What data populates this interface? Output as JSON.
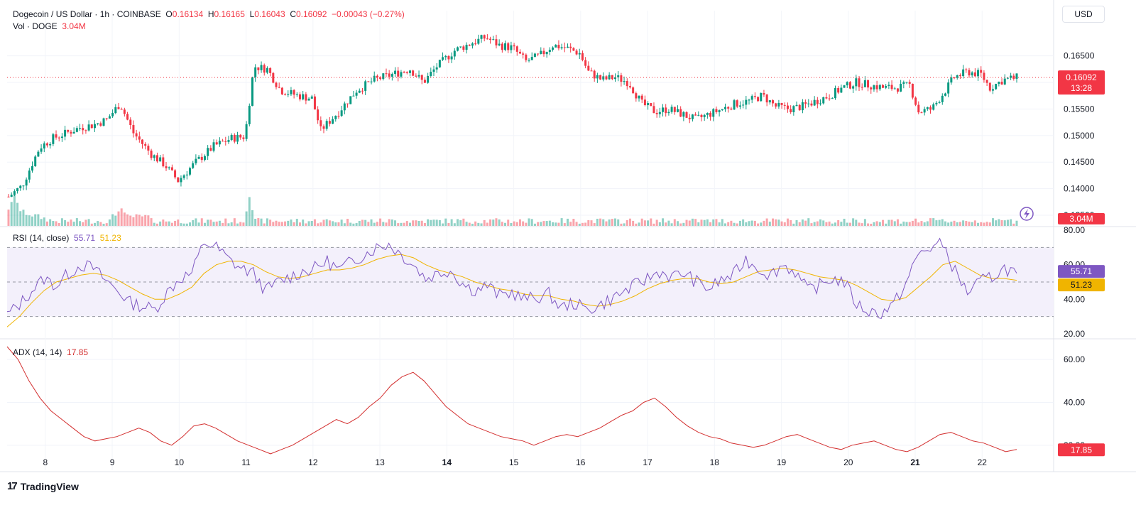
{
  "header": {
    "title": "Dogecoin / US Dollar · 1h · COINBASE",
    "o_key": "O",
    "o_val": "0.16134",
    "h_key": "H",
    "h_val": "0.16165",
    "l_key": "L",
    "l_val": "0.16043",
    "c_key": "C",
    "c_val": "0.16092",
    "change": "−0.00043 (−0.27%)",
    "vol_label": "Vol · DOGE",
    "vol_value": "3.04M"
  },
  "currency_button": "USD",
  "price_badge": {
    "value": "0.16092",
    "countdown": "13:28"
  },
  "volume_badge": "3.04M",
  "rsi_label": {
    "name": "RSI (14, close)",
    "value": "55.71",
    "ma": "51.23"
  },
  "rsi_badges": {
    "value": "55.71",
    "ma": "51.23"
  },
  "adx_label": {
    "name": "ADX (14, 14)",
    "value": "17.85"
  },
  "adx_badge": "17.85",
  "logo_text": "TradingView",
  "colors": {
    "up": "#089981",
    "down": "#f23645",
    "rsi": "#7e57c2",
    "rsi_ma": "#f0b400",
    "adx": "#d32f2f",
    "band": "#f3f0fb"
  },
  "chart_data": [
    {
      "type": "candlestick",
      "title": "Dogecoin / US Dollar · 1h · COINBASE",
      "x_ticks": [
        "8",
        "9",
        "10",
        "11",
        "12",
        "13",
        "14",
        "15",
        "16",
        "17",
        "18",
        "19",
        "20",
        "21",
        "22"
      ],
      "y_ticks": [
        "0.16500",
        "0.16000",
        "0.15500",
        "0.15000",
        "0.14500",
        "0.14000",
        "0.13500"
      ],
      "ylim": [
        0.133,
        0.1695
      ],
      "last_price": 0.16092,
      "close_path": [
        [
          0,
          0.1385
        ],
        [
          0.3,
          0.1405
        ],
        [
          0.7,
          0.1478
        ],
        [
          1.0,
          0.1495
        ],
        [
          1.3,
          0.1505
        ],
        [
          1.6,
          0.1515
        ],
        [
          1.9,
          0.152
        ],
        [
          2.2,
          0.153
        ],
        [
          2.5,
          0.156
        ],
        [
          2.8,
          0.1505
        ],
        [
          3.2,
          0.1465
        ],
        [
          3.5,
          0.1445
        ],
        [
          3.8,
          0.1415
        ],
        [
          4.2,
          0.145
        ],
        [
          4.6,
          0.148
        ],
        [
          5.0,
          0.1495
        ],
        [
          5.3,
          0.1498
        ],
        [
          5.5,
          0.163
        ],
        [
          5.8,
          0.1625
        ],
        [
          6.1,
          0.1585
        ],
        [
          6.5,
          0.1575
        ],
        [
          6.8,
          0.157
        ],
        [
          7.0,
          0.151
        ],
        [
          7.4,
          0.1545
        ],
        [
          7.8,
          0.1585
        ],
        [
          8.2,
          0.1605
        ],
        [
          8.6,
          0.1615
        ],
        [
          9.0,
          0.1625
        ],
        [
          9.3,
          0.16
        ],
        [
          9.6,
          0.163
        ],
        [
          10.0,
          0.166
        ],
        [
          10.4,
          0.1675
        ],
        [
          10.7,
          0.1685
        ],
        [
          11.0,
          0.167
        ],
        [
          11.3,
          0.1665
        ],
        [
          11.6,
          0.164
        ],
        [
          11.9,
          0.165
        ],
        [
          12.2,
          0.167
        ],
        [
          12.5,
          0.1665
        ],
        [
          12.8,
          0.1655
        ],
        [
          13.0,
          0.162
        ],
        [
          13.3,
          0.1605
        ],
        [
          13.6,
          0.161
        ],
        [
          13.9,
          0.16
        ],
        [
          14.2,
          0.156
        ],
        [
          14.5,
          0.1545
        ],
        [
          14.8,
          0.155
        ],
        [
          15.1,
          0.154
        ],
        [
          15.4,
          0.153
        ],
        [
          15.7,
          0.154
        ],
        [
          16.0,
          0.155
        ],
        [
          16.3,
          0.156
        ],
        [
          16.6,
          0.1565
        ],
        [
          16.9,
          0.1575
        ],
        [
          17.2,
          0.1555
        ],
        [
          17.5,
          0.155
        ],
        [
          17.8,
          0.1555
        ],
        [
          18.1,
          0.1565
        ],
        [
          18.4,
          0.1575
        ],
        [
          18.7,
          0.159
        ],
        [
          19.0,
          0.16
        ],
        [
          19.3,
          0.1595
        ],
        [
          19.6,
          0.159
        ],
        [
          19.9,
          0.159
        ],
        [
          20.2,
          0.1595
        ],
        [
          20.4,
          0.1545
        ],
        [
          20.7,
          0.155
        ],
        [
          21.0,
          0.1585
        ],
        [
          21.2,
          0.161
        ],
        [
          21.5,
          0.162
        ],
        [
          21.8,
          0.1615
        ],
        [
          22.0,
          0.159
        ],
        [
          22.3,
          0.1605
        ],
        [
          22.6,
          0.1609
        ]
      ],
      "day_positions": [
        0.55,
        1.55,
        2.55,
        3.55,
        4.55,
        5.55,
        6.55,
        7.55,
        8.55,
        9.55,
        10.55,
        11.55,
        12.55,
        13.55,
        14.55
      ],
      "volume_spikes": [
        [
          0.15,
          0.45
        ],
        [
          2.5,
          0.3
        ],
        [
          5.4,
          0.75
        ]
      ]
    },
    {
      "type": "line",
      "title": "RSI (14, close)",
      "series": [
        {
          "name": "RSI (14, close)",
          "values": [
            31,
            37,
            45,
            52,
            48,
            55,
            60,
            58,
            51,
            45,
            38,
            36,
            34,
            44,
            52,
            55,
            73,
            70,
            63,
            58,
            55,
            45,
            50,
            53,
            56,
            58,
            62,
            57,
            62,
            66,
            70,
            72,
            66,
            60,
            52,
            55,
            57,
            49,
            45,
            48,
            42,
            44,
            40,
            41,
            43,
            35,
            38,
            34,
            36,
            40,
            44,
            48,
            52,
            56,
            53,
            55,
            50,
            46,
            51,
            54,
            63,
            58,
            54,
            60,
            56,
            45,
            48,
            52,
            50,
            37,
            33,
            32,
            37,
            49,
            66,
            70,
            72,
            56,
            44,
            50,
            53,
            58,
            55
          ]
        },
        {
          "name": "51.23",
          "values": [
            24,
            30,
            38,
            45,
            50,
            52,
            54,
            55,
            54,
            51,
            47,
            43,
            40,
            40,
            43,
            47,
            55,
            60,
            62,
            62,
            60,
            56,
            53,
            52,
            53,
            55,
            57,
            57,
            58,
            60,
            63,
            65,
            66,
            64,
            60,
            57,
            55,
            53,
            50,
            48,
            46,
            45,
            43,
            42,
            42,
            40,
            39,
            37,
            36,
            37,
            39,
            42,
            46,
            49,
            51,
            52,
            52,
            50,
            49,
            50,
            53,
            56,
            57,
            58,
            57,
            55,
            53,
            52,
            51,
            48,
            44,
            40,
            39,
            41,
            47,
            53,
            60,
            62,
            58,
            54,
            52,
            52,
            51
          ]
        }
      ],
      "y_ticks": [
        "80.00",
        "60.00",
        "40.00",
        "20.00"
      ],
      "ylim": [
        20,
        80
      ],
      "bands": [
        30,
        70
      ]
    },
    {
      "type": "line",
      "title": "ADX (14, 14)",
      "series": [
        {
          "name": "ADX (14, 14)",
          "values": [
            66,
            60,
            50,
            42,
            36,
            32,
            28,
            24,
            22,
            23,
            24,
            26,
            28,
            26,
            22,
            20,
            24,
            29,
            30,
            28,
            25,
            22,
            20,
            18,
            16,
            18,
            20,
            23,
            26,
            29,
            32,
            30,
            33,
            38,
            42,
            48,
            52,
            54,
            50,
            44,
            38,
            34,
            30,
            28,
            26,
            24,
            23,
            22,
            20,
            22,
            24,
            25,
            24,
            26,
            28,
            31,
            34,
            36,
            40,
            42,
            38,
            33,
            29,
            26,
            24,
            23,
            21,
            20,
            19,
            20,
            22,
            24,
            25,
            23,
            21,
            19,
            18,
            20,
            21,
            22,
            20,
            18,
            17,
            19,
            22,
            25,
            26,
            24,
            22,
            21,
            19,
            17,
            18
          ]
        }
      ],
      "y_ticks": [
        "60.00",
        "40.00",
        "20.00"
      ],
      "ylim": [
        9,
        68
      ]
    }
  ]
}
